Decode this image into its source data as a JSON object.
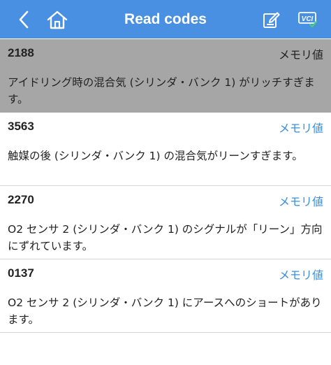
{
  "header": {
    "title": "Read codes",
    "back_icon": "chevron-left-icon",
    "home_icon": "home-icon",
    "edit_icon": "edit-icon",
    "vci_label": "VCI"
  },
  "colors": {
    "header_bg": "#4a90e2",
    "selected_bg": "#a6a6a6",
    "link": "#3a8fdc"
  },
  "codes": [
    {
      "code": "2188",
      "freeze": "メモリ値",
      "description": "アイドリング時の混合気 (シリンダ・バンク 1) がリッチすぎます。",
      "selected": true
    },
    {
      "code": "3563",
      "freeze": "メモリ値",
      "description": "触媒の後 (シリンダ・バンク 1) の混合気がリーンすぎます。",
      "selected": false
    },
    {
      "code": "2270",
      "freeze": "メモリ値",
      "description": "O2 センサ 2 (シリンダ・バンク 1) のシグナルが「リーン」方向にずれています。",
      "selected": false
    },
    {
      "code": "0137",
      "freeze": "メモリ値",
      "description": "O2 センサ 2 (シリンダ・バンク 1) にアースへのショートがあります。",
      "selected": false
    }
  ]
}
